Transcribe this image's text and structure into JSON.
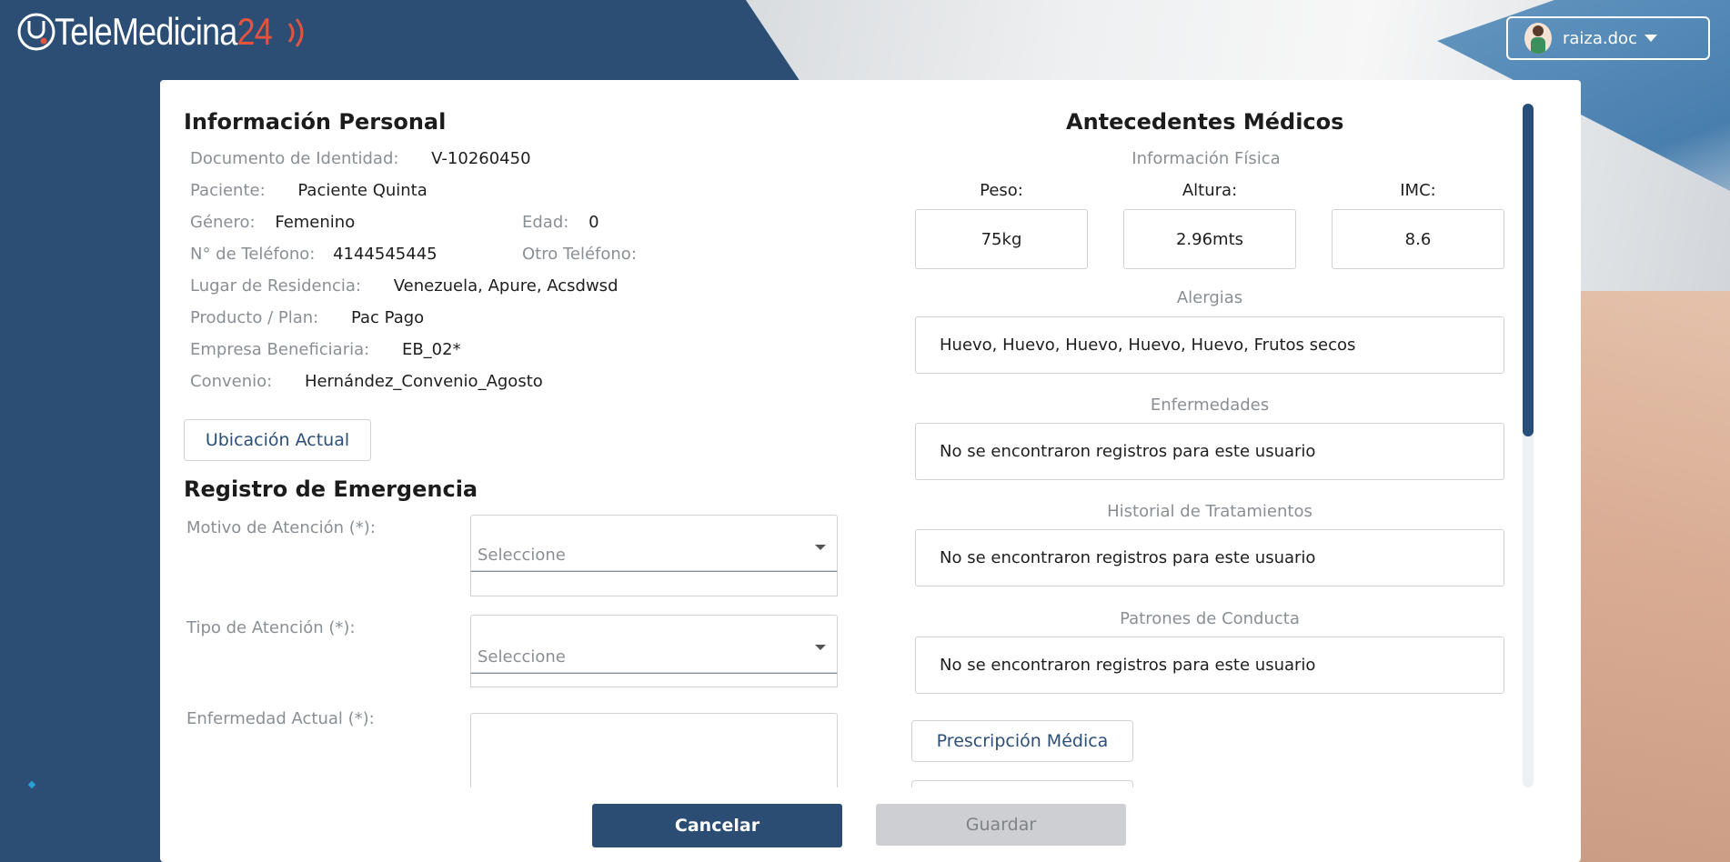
{
  "app": {
    "logo_text": "TeleMedicina",
    "logo_number": "24"
  },
  "user": {
    "name": "raiza.doc"
  },
  "personal": {
    "title": "Información Personal",
    "document_label": "Documento de Identidad:",
    "document_value": "V-10260450",
    "patient_label": "Paciente:",
    "patient_value": "Paciente Quinta",
    "gender_label": "Género:",
    "gender_value": "Femenino",
    "age_label": "Edad:",
    "age_value": "0",
    "phone_label": "N° de Teléfono:",
    "phone_value": "4144545445",
    "other_phone_label": "Otro Teléfono:",
    "residence_label": "Lugar de Residencia:",
    "residence_value": "Venezuela, Apure, Acsdwsd",
    "plan_label": "Producto / Plan:",
    "plan_value": "Pac Pago",
    "company_label": "Empresa Beneficiaria:",
    "company_value": "EB_02*",
    "agreement_label": "Convenio:",
    "agreement_value": "Hernández_Convenio_Agosto",
    "location_button": "Ubicación Actual"
  },
  "emergency": {
    "title": "Registro de Emergencia",
    "reason_label": "Motivo de Atención (*):",
    "reason_placeholder": "Seleccione",
    "type_label": "Tipo de Atención (*):",
    "type_placeholder": "Seleccione",
    "illness_label": "Enfermedad Actual (*):"
  },
  "medical": {
    "title": "Antecedentes Médicos",
    "physical_label": "Información Física",
    "weight_label": "Peso:",
    "weight_value": "75kg",
    "height_label": "Altura:",
    "height_value": "2.96mts",
    "bmi_label": "IMC:",
    "bmi_value": "8.6",
    "allergies_label": "Alergias",
    "allergies_value": "Huevo, Huevo, Huevo, Huevo, Huevo, Frutos secos",
    "diseases_label": "Enfermedades",
    "diseases_value": "No se encontraron registros para este usuario",
    "treatments_label": "Historial de Tratamientos",
    "treatments_value": "No se encontraron registros para este usuario",
    "behavior_label": "Patrones de Conducta",
    "behavior_value": "No se encontraron registros para este usuario",
    "prescription_button": "Prescripción Médica"
  },
  "footer": {
    "cancel_label": "Cancelar",
    "save_label": "Guardar"
  },
  "colors": {
    "primary": "#2b4d74",
    "accent": "#e2543f",
    "muted": "#8a8f94"
  }
}
